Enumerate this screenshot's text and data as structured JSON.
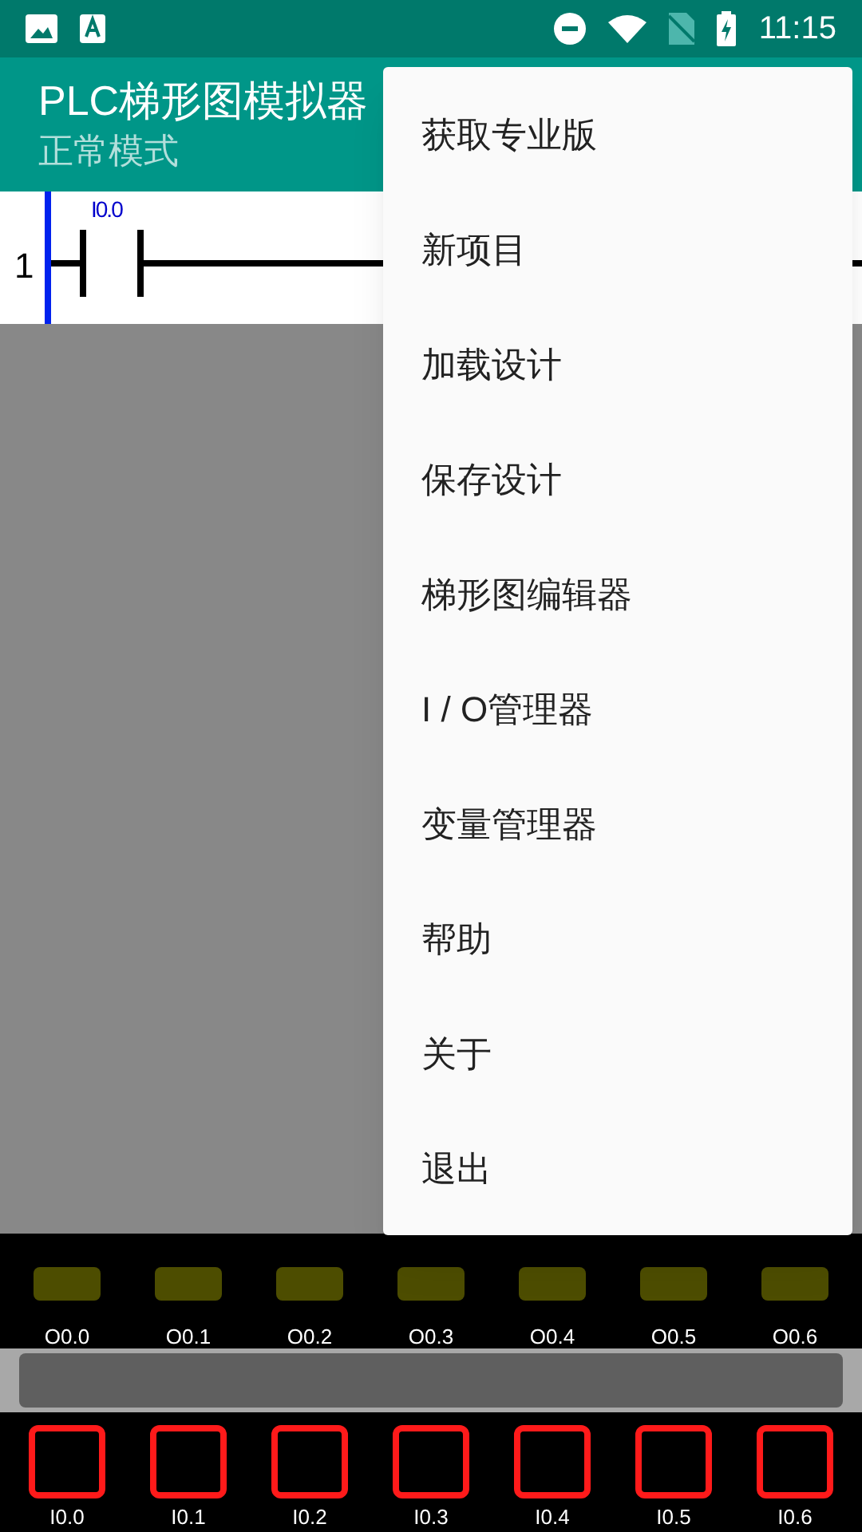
{
  "status_bar": {
    "time": "11:15"
  },
  "app_bar": {
    "title": "PLC梯形图模拟器",
    "subtitle": "正常模式"
  },
  "ladder": {
    "rung_number": "1",
    "contact_label": "I0.0"
  },
  "outputs": [
    {
      "label": "O0.0",
      "on": false
    },
    {
      "label": "O0.1",
      "on": false
    },
    {
      "label": "O0.2",
      "on": false
    },
    {
      "label": "O0.3",
      "on": false
    },
    {
      "label": "O0.4",
      "on": false
    },
    {
      "label": "O0.5",
      "on": false
    },
    {
      "label": "O0.6",
      "on": false
    }
  ],
  "inputs": [
    {
      "label": "I0.0",
      "on": false
    },
    {
      "label": "I0.1",
      "on": false
    },
    {
      "label": "I0.2",
      "on": false
    },
    {
      "label": "I0.3",
      "on": false
    },
    {
      "label": "I0.4",
      "on": false
    },
    {
      "label": "I0.5",
      "on": false
    },
    {
      "label": "I0.6",
      "on": false
    }
  ],
  "menu": {
    "items": [
      "获取专业版",
      "新项目",
      "加载设计",
      "保存设计",
      "梯形图编辑器",
      "I / O管理器",
      "变量管理器",
      "帮助",
      "关于",
      "退出"
    ]
  }
}
